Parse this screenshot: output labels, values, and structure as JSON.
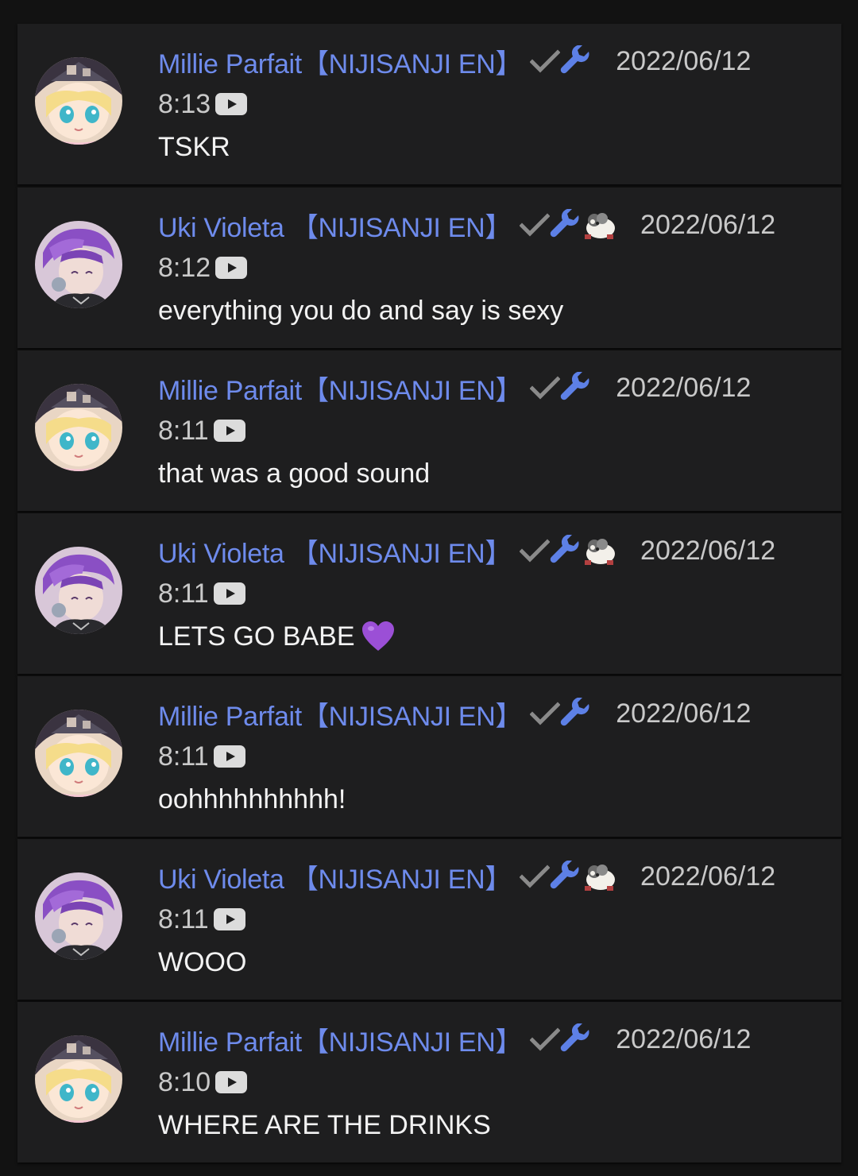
{
  "colors": {
    "background": "#121212",
    "card": "#1e1e1f",
    "author": "#6e8bec",
    "meta": "#c9c9c9",
    "message": "#f2f2f2",
    "verified": "#8a8a8a",
    "moderator": "#5d80e6",
    "heart": "#9b4fd6"
  },
  "comments": [
    {
      "author": "Millie Parfait【NIJISANJI EN】",
      "avatar": "millie-avatar",
      "badges": [
        "checkmark-icon",
        "wrench-icon"
      ],
      "date": "2022/06/12",
      "time": "8:13",
      "source_icon": "youtube-icon",
      "message": "TSKR"
    },
    {
      "author": "Uki Violeta 【NIJISANJI EN】",
      "avatar": "uki-avatar",
      "badges": [
        "checkmark-icon",
        "wrench-icon",
        "member-badge-icon"
      ],
      "date": "2022/06/12",
      "time": "8:12",
      "source_icon": "youtube-icon",
      "message": "everything you do and say is sexy"
    },
    {
      "author": "Millie Parfait【NIJISANJI EN】",
      "avatar": "millie-avatar",
      "badges": [
        "checkmark-icon",
        "wrench-icon"
      ],
      "date": "2022/06/12",
      "time": "8:11",
      "source_icon": "youtube-icon",
      "message": "that was a good sound"
    },
    {
      "author": "Uki Violeta 【NIJISANJI EN】",
      "avatar": "uki-avatar",
      "badges": [
        "checkmark-icon",
        "wrench-icon",
        "member-badge-icon"
      ],
      "date": "2022/06/12",
      "time": "8:11",
      "source_icon": "youtube-icon",
      "message": "LETS GO BABE",
      "emoji": "purple-heart-icon"
    },
    {
      "author": "Millie Parfait【NIJISANJI EN】",
      "avatar": "millie-avatar",
      "badges": [
        "checkmark-icon",
        "wrench-icon"
      ],
      "date": "2022/06/12",
      "time": "8:11",
      "source_icon": "youtube-icon",
      "message": "oohhhhhhhhhh!"
    },
    {
      "author": "Uki Violeta 【NIJISANJI EN】",
      "avatar": "uki-avatar",
      "badges": [
        "checkmark-icon",
        "wrench-icon",
        "member-badge-icon"
      ],
      "date": "2022/06/12",
      "time": "8:11",
      "source_icon": "youtube-icon",
      "message": "WOOO"
    },
    {
      "author": "Millie Parfait【NIJISANJI EN】",
      "avatar": "millie-avatar",
      "badges": [
        "checkmark-icon",
        "wrench-icon"
      ],
      "date": "2022/06/12",
      "time": "8:10",
      "source_icon": "youtube-icon",
      "message": "WHERE ARE THE DRINKS"
    }
  ]
}
